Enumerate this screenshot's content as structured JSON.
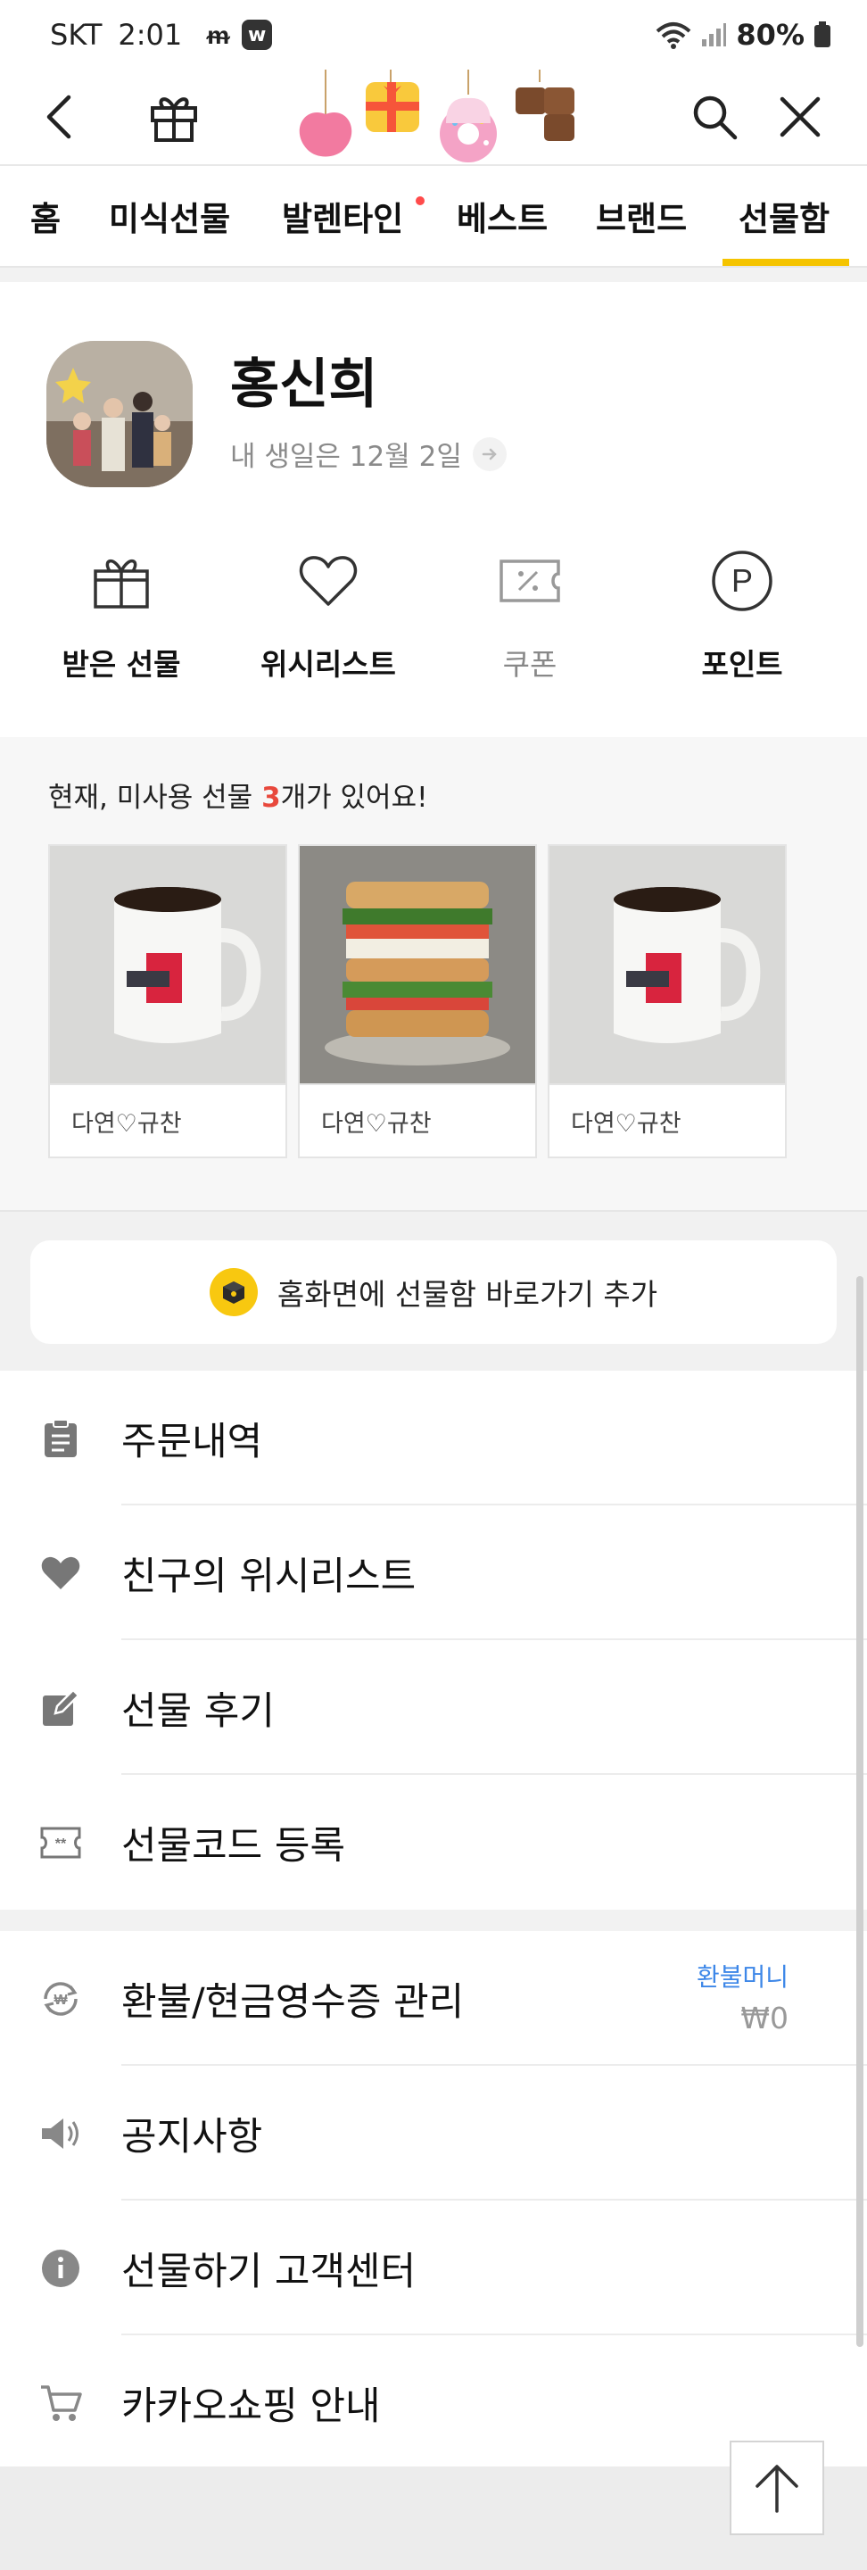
{
  "status_bar": {
    "carrier": "SKT",
    "time": "2:01",
    "battery": "80%"
  },
  "tabs": [
    {
      "label": "홈"
    },
    {
      "label": "미식선물"
    },
    {
      "label": "발렌타인"
    },
    {
      "label": "베스트"
    },
    {
      "label": "브랜드"
    },
    {
      "label": "선물함"
    }
  ],
  "active_tab": "선물함",
  "profile": {
    "name": "홍신희",
    "birthday": "내 생일은 12월 2일"
  },
  "quick_menu": [
    {
      "label": "받은 선물",
      "icon": "gift-box-icon"
    },
    {
      "label": "위시리스트",
      "icon": "heart-icon"
    },
    {
      "label": "쿠폰",
      "icon": "coupon-icon"
    },
    {
      "label": "포인트",
      "icon": "point-p-icon"
    }
  ],
  "unused_gifts": {
    "prefix": "현재, 미사용 선물 ",
    "count": "3",
    "suffix": "개가 있어요!",
    "items": [
      {
        "label": "다연♡규찬",
        "image": "coffee-mug"
      },
      {
        "label": "다연♡규찬",
        "image": "sandwich"
      },
      {
        "label": "다연♡규찬",
        "image": "coffee-mug"
      }
    ]
  },
  "shortcut": {
    "label": "홈화면에 선물함 바로가기 추가"
  },
  "menu_group1": [
    {
      "label": "주문내역",
      "icon": "clipboard-icon"
    },
    {
      "label": "친구의 위시리스트",
      "icon": "heart-filled-icon"
    },
    {
      "label": "선물 후기",
      "icon": "edit-icon"
    },
    {
      "label": "선물코드 등록",
      "icon": "code-ticket-icon"
    }
  ],
  "menu_group2": [
    {
      "label": "환불/현금영수증 관리",
      "icon": "refund-won-icon",
      "extra_label": "환불머니",
      "extra_value": "₩0"
    },
    {
      "label": "공지사항",
      "icon": "speaker-icon"
    },
    {
      "label": "선물하기 고객센터",
      "icon": "info-icon"
    },
    {
      "label": "카카오쇼핑 안내",
      "icon": "cart-icon"
    }
  ],
  "colors": {
    "accent_yellow": "#f5c400",
    "count_red": "#e8483c",
    "refund_blue": "#3d87e8",
    "tab_dot": "#ff4b4b"
  }
}
